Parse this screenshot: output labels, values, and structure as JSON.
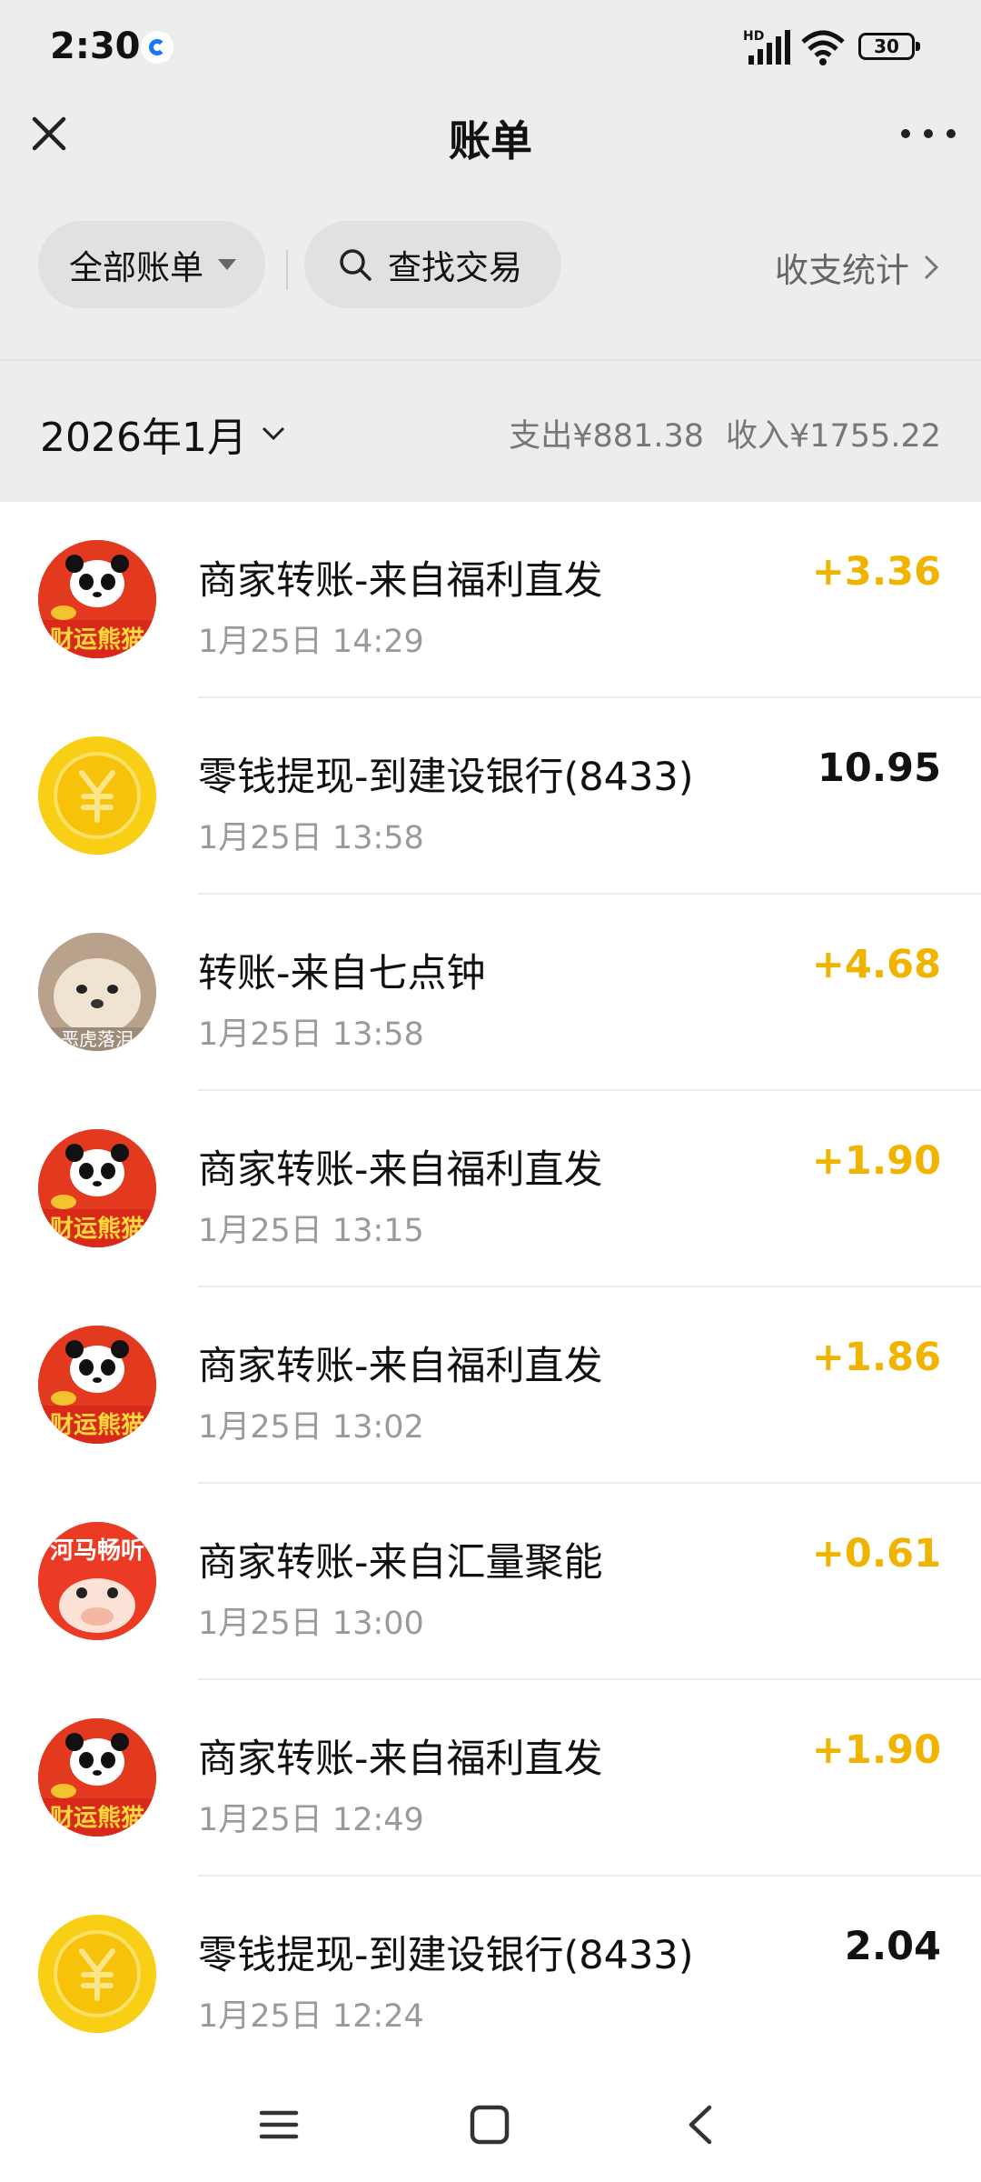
{
  "status_bar": {
    "time": "2:30",
    "battery": "30",
    "network": "HD"
  },
  "header": {
    "title": "账单"
  },
  "filters": {
    "all_bills": "全部账单",
    "search": "查找交易",
    "stats": "收支统计"
  },
  "month_summary": {
    "month": "2026年1月",
    "expense": "支出¥881.38",
    "income": "收入¥1755.22"
  },
  "transactions": [
    {
      "title": "商家转账-来自福利直发",
      "time": "1月25日 14:29",
      "amount": "+3.36",
      "type": "income",
      "avatar": "panda-logo"
    },
    {
      "title": "零钱提现-到建设银行(8433)",
      "time": "1月25日 13:58",
      "amount": "10.95",
      "type": "expense",
      "avatar": "yuan-coin-icon"
    },
    {
      "title": "转账-来自七点钟",
      "time": "1月25日 13:58",
      "amount": "+4.68",
      "type": "income",
      "avatar": "dog-photo"
    },
    {
      "title": "商家转账-来自福利直发",
      "time": "1月25日 13:15",
      "amount": "+1.90",
      "type": "income",
      "avatar": "panda-logo"
    },
    {
      "title": "商家转账-来自福利直发",
      "time": "1月25日 13:02",
      "amount": "+1.86",
      "type": "income",
      "avatar": "panda-logo"
    },
    {
      "title": "商家转账-来自汇量聚能",
      "time": "1月25日 13:00",
      "amount": "+0.61",
      "type": "income",
      "avatar": "hippo-logo"
    },
    {
      "title": "商家转账-来自福利直发",
      "time": "1月25日 12:49",
      "amount": "+1.90",
      "type": "income",
      "avatar": "panda-logo"
    },
    {
      "title": "零钱提现-到建设银行(8433)",
      "time": "1月25日 12:24",
      "amount": "2.04",
      "type": "expense",
      "avatar": "yuan-coin-icon"
    }
  ],
  "colors": {
    "income": "#f0b400",
    "expense": "#111111",
    "header_bg": "#ededed"
  }
}
